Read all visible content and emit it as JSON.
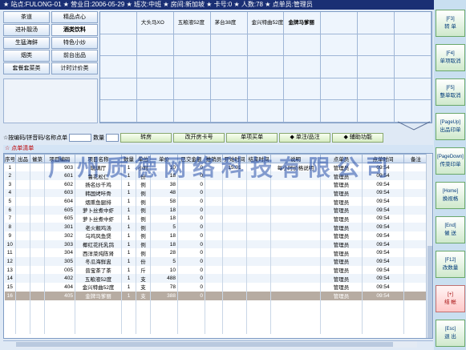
{
  "title": "★ 站点:FULONG-01 ★ 营业日:2006-05-29 ★ 班次:中班 ★ 房间:新加坡 ★ 卡号:0 ★ 人数:78 ★ 点单员:管理员",
  "categories": [
    {
      "label": "茶道",
      "selected": false
    },
    {
      "label": "精品点心",
      "selected": false
    },
    {
      "label": "进补靓汤",
      "selected": false
    },
    {
      "label": "酒类饮料",
      "selected": true
    },
    {
      "label": "生猛海鲜",
      "selected": false
    },
    {
      "label": "特色小炒",
      "selected": false
    },
    {
      "label": "烟类",
      "selected": false
    },
    {
      "label": "前台出品",
      "selected": false
    },
    {
      "label": "套餐套菜类",
      "selected": false
    },
    {
      "label": "计时计价类",
      "selected": false
    }
  ],
  "dishes": [
    {
      "label": "",
      "selected": false
    },
    {
      "label": "大头马XO",
      "selected": false
    },
    {
      "label": "五粮液52度",
      "selected": false
    },
    {
      "label": "茅台38度",
      "selected": false
    },
    {
      "label": "金兴特曲52度",
      "selected": false
    },
    {
      "label": "金牌马爹丽",
      "selected": true
    }
  ],
  "toolbar": {
    "search_label": "☆按编码/拼音码/名称点单",
    "qty_label": "数量",
    "buttons": [
      "转房",
      "改开房卡号",
      "单项买单",
      "◆ 单注/品注",
      "◆ 辅助功能"
    ]
  },
  "order_title": "☆ 点单清单",
  "table": {
    "headers": [
      "序号",
      "出品",
      "催菜",
      "项目编码",
      "项目名称",
      "数量",
      "单位",
      "单价",
      "已交金额",
      "推销员",
      "开始时间",
      "结束时间",
      "说明",
      "点单员",
      "点单时间",
      "备注"
    ],
    "rows": [
      [
        "1",
        "",
        "",
        "903",
        "琉璃厅",
        "1",
        "小时",
        "10",
        "0",
        "",
        "15:01",
        "",
        "每小时价格说明",
        "管理员",
        "09:54",
        ""
      ],
      [
        "2",
        "",
        "",
        "601",
        "鲁花松仁",
        "1",
        "份",
        "18",
        "0",
        "",
        "",
        "",
        "",
        "管理员",
        "09:54",
        ""
      ],
      [
        "3",
        "",
        "",
        "602",
        "扬名炒千鸡",
        "1",
        "例",
        "38",
        "0",
        "",
        "",
        "",
        "",
        "管理员",
        "09:54",
        ""
      ],
      [
        "4",
        "",
        "",
        "603",
        "韩国烤咔骨",
        "1",
        "例",
        "48",
        "0",
        "",
        "",
        "",
        "",
        "管理员",
        "09:54",
        ""
      ],
      [
        "5",
        "",
        "",
        "604",
        "烟熏鱼腿排",
        "1",
        "例",
        "58",
        "0",
        "",
        "",
        "",
        "",
        "管理员",
        "09:54",
        ""
      ],
      [
        "6",
        "",
        "",
        "605",
        "萝卜丝煮中虾",
        "1",
        "例",
        "18",
        "0",
        "",
        "",
        "",
        "",
        "管理员",
        "09:54",
        ""
      ],
      [
        "7",
        "",
        "",
        "605",
        "萝卜丝煮中虾",
        "1",
        "例",
        "18",
        "0",
        "",
        "",
        "",
        "",
        "管理员",
        "09:54",
        ""
      ],
      [
        "8",
        "",
        "",
        "301",
        "老火靓鸡汤",
        "1",
        "例",
        "5",
        "0",
        "",
        "",
        "",
        "",
        "管理员",
        "09:54",
        ""
      ],
      [
        "9",
        "",
        "",
        "302",
        "乌鸡风鱼煲",
        "1",
        "例",
        "18",
        "0",
        "",
        "",
        "",
        "",
        "管理员",
        "09:54",
        ""
      ],
      [
        "10",
        "",
        "",
        "303",
        "椰红花托乳鸽",
        "1",
        "例",
        "18",
        "0",
        "",
        "",
        "",
        "",
        "管理员",
        "09:54",
        ""
      ],
      [
        "11",
        "",
        "",
        "304",
        "西洋菜炖陈肾",
        "1",
        "例",
        "28",
        "0",
        "",
        "",
        "",
        "",
        "管理员",
        "09:54",
        ""
      ],
      [
        "12",
        "",
        "",
        "305",
        "冬瓜海鲜盅",
        "1",
        "份",
        "5",
        "0",
        "",
        "",
        "",
        "",
        "管理员",
        "09:54",
        ""
      ],
      [
        "13",
        "",
        "",
        "005",
        "普宝茶了茶",
        "1",
        "斤",
        "10",
        "0",
        "",
        "",
        "",
        "",
        "管理员",
        "09:54",
        ""
      ],
      [
        "14",
        "",
        "",
        "402",
        "五粮液52度",
        "1",
        "支",
        "488",
        "0",
        "",
        "",
        "",
        "",
        "管理员",
        "09:54",
        ""
      ],
      [
        "15",
        "",
        "",
        "404",
        "金兴特曲52度",
        "1",
        "支",
        "78",
        "0",
        "",
        "",
        "",
        "",
        "管理员",
        "09:54",
        ""
      ],
      [
        "16",
        "",
        "",
        "405",
        "金牌马爹丽",
        "1",
        "支",
        "388",
        "0",
        "",
        "",
        "",
        "",
        "管理员",
        "09:54",
        ""
      ]
    ],
    "selected_row": 15
  },
  "function_keys": [
    {
      "key": "[F3]",
      "label": "转 单",
      "highlight": false
    },
    {
      "key": "[F4]",
      "label": "单项取消",
      "highlight": false
    },
    {
      "key": "[F5]",
      "label": "整单取消",
      "highlight": false
    },
    {
      "key": "[PageUp]",
      "label": "出品印单",
      "highlight": false
    },
    {
      "key": "[PageDown]",
      "label": "传菜印单",
      "highlight": false
    },
    {
      "key": "[Home]",
      "label": "换视格",
      "highlight": false
    },
    {
      "key": "[End]",
      "label": "催 送",
      "highlight": false
    },
    {
      "key": "[F12]",
      "label": "改数量",
      "highlight": false
    },
    {
      "key": "[+]",
      "label": "结 帐",
      "highlight": true
    },
    {
      "key": "[Esc]",
      "label": "退 出",
      "highlight": false
    }
  ],
  "watermark": "广州质德网络科技有限公司"
}
